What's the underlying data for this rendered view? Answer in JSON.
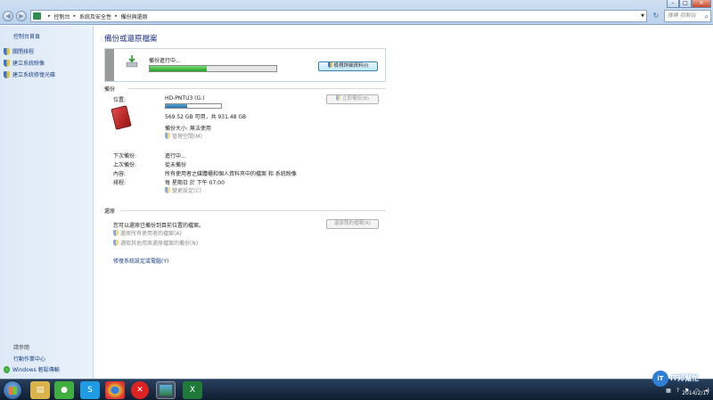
{
  "window": {
    "controls": [
      "–",
      "□",
      "✕"
    ],
    "address": [
      "控制台",
      "系統及安全性",
      "備份與還原"
    ],
    "search_placeholder": "搜尋 控制台"
  },
  "sidebar": {
    "home": "控制台首頁",
    "tasks": [
      "關閉排程",
      "建立系統映像",
      "建立系統修復光碟"
    ],
    "see_also": "請參閱",
    "links": [
      "行動作業中心",
      "Windows 輕鬆傳輸"
    ]
  },
  "main": {
    "title": "備份或還原檔案",
    "status": {
      "text": "備份進行中...",
      "progress": 0.45,
      "button": "檢視詳細資料(I)"
    },
    "backup": {
      "heading": "備份",
      "location_label": "位置:",
      "drive_name": "HD-PNTU3 (G:)",
      "drive_used_fraction": 0.39,
      "drive_space": "569.52 GB 可用，共 931.48 GB",
      "backup_size": "備份大小: 無法使用",
      "manage_space": "管理空間(M)",
      "backup_now": "立即備份(B)",
      "next_label": "下次備份:",
      "next_value": "進行中...",
      "last_label": "上次備份:",
      "last_value": "從未備份",
      "contents_label": "內容:",
      "contents_value": "所有使用者之媒體櫃和個人資料夾中的檔案 和 系統映像",
      "schedule_label": "排程:",
      "schedule_value": "每 星期日 於 下午 07:00",
      "change_settings": "變更設定(C)"
    },
    "restore": {
      "heading": "還原",
      "desc": "您可以還原已備份到目前位置的檔案。",
      "restore_button": "還原我的檔案(R)",
      "restore_all": "還原所有使用者的檔案(A)",
      "select_other": "選取其他用來還原檔案的備份(N)",
      "recover_settings": "修復系統設定或電腦(Y)"
    }
  },
  "taskbar": {
    "apps": [
      "explorer",
      "line",
      "skype",
      "chrome",
      "close-app",
      "control-panel",
      "excel"
    ],
    "date": "2014/2/17"
  },
  "watermark": "iT邦幫忙"
}
